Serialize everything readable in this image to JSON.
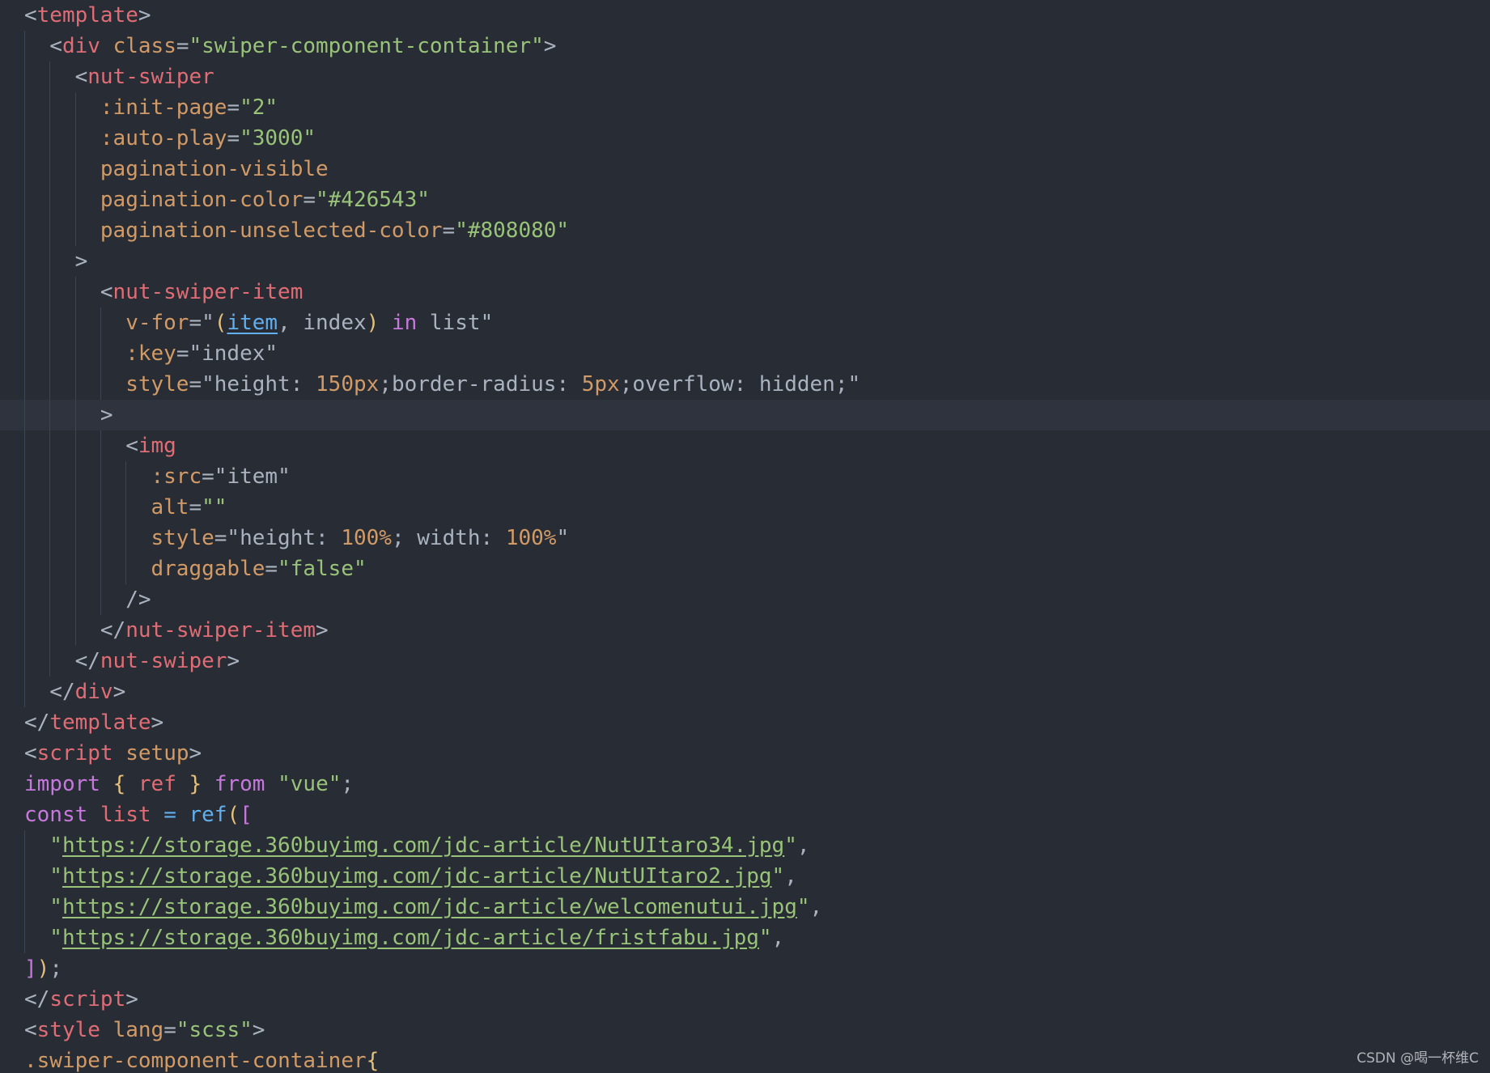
{
  "editor": {
    "active_line": 13,
    "lines": [
      {
        "indent": 0,
        "tokens": [
          [
            "punc",
            "<"
          ],
          [
            "tag",
            "template"
          ],
          [
            "punc",
            ">"
          ]
        ]
      },
      {
        "indent": 1,
        "tokens": [
          [
            "punc",
            "<"
          ],
          [
            "tag",
            "div"
          ],
          [
            "attr",
            " class"
          ],
          [
            "punc",
            "="
          ],
          [
            "str",
            "\"swiper-component-container\""
          ],
          [
            "punc",
            ">"
          ]
        ]
      },
      {
        "indent": 2,
        "tokens": [
          [
            "punc",
            "<"
          ],
          [
            "tag",
            "nut-swiper"
          ]
        ]
      },
      {
        "indent": 3,
        "tokens": [
          [
            "attr",
            ":init-page"
          ],
          [
            "punc",
            "="
          ],
          [
            "str",
            "\"2\""
          ]
        ]
      },
      {
        "indent": 3,
        "tokens": [
          [
            "attr",
            ":auto-play"
          ],
          [
            "punc",
            "="
          ],
          [
            "str",
            "\"3000\""
          ]
        ]
      },
      {
        "indent": 3,
        "tokens": [
          [
            "attr",
            "pagination-visible"
          ]
        ]
      },
      {
        "indent": 3,
        "tokens": [
          [
            "attr",
            "pagination-color"
          ],
          [
            "punc",
            "="
          ],
          [
            "str",
            "\"#426543\""
          ]
        ]
      },
      {
        "indent": 3,
        "tokens": [
          [
            "attr",
            "pagination-unselected-color"
          ],
          [
            "punc",
            "="
          ],
          [
            "str",
            "\"#808080\""
          ]
        ]
      },
      {
        "indent": 2,
        "tokens": [
          [
            "punc",
            ">"
          ]
        ]
      },
      {
        "indent": 3,
        "tokens": [
          [
            "punc",
            "<"
          ],
          [
            "tag",
            "nut-swiper-item"
          ]
        ]
      },
      {
        "indent": 4,
        "tokens": [
          [
            "attr",
            "v-for"
          ],
          [
            "punc",
            "=\""
          ],
          [
            "br1",
            "("
          ],
          [
            "fnlink",
            "item"
          ],
          [
            "punc",
            ", "
          ],
          [
            "plain",
            "index"
          ],
          [
            "br1",
            ")"
          ],
          [
            "plain",
            " "
          ],
          [
            "kw",
            "in"
          ],
          [
            "plain",
            " list"
          ],
          [
            "punc",
            "\""
          ]
        ]
      },
      {
        "indent": 4,
        "tokens": [
          [
            "attr",
            ":key"
          ],
          [
            "punc",
            "=\""
          ],
          [
            "plain",
            "index"
          ],
          [
            "punc",
            "\""
          ]
        ]
      },
      {
        "indent": 4,
        "tokens": [
          [
            "attr",
            "style"
          ],
          [
            "punc",
            "=\""
          ],
          [
            "plain",
            "height: "
          ],
          [
            "num",
            "150px"
          ],
          [
            "plain",
            ";border-radius: "
          ],
          [
            "num",
            "5px"
          ],
          [
            "plain",
            ";overflow: hidden;"
          ],
          [
            "punc",
            "\""
          ]
        ]
      },
      {
        "indent": 3,
        "tokens": [
          [
            "punc",
            ">"
          ]
        ]
      },
      {
        "indent": 4,
        "tokens": [
          [
            "punc",
            "<"
          ],
          [
            "tag",
            "img"
          ]
        ]
      },
      {
        "indent": 5,
        "tokens": [
          [
            "attr",
            ":src"
          ],
          [
            "punc",
            "=\""
          ],
          [
            "plain",
            "item"
          ],
          [
            "punc",
            "\""
          ]
        ]
      },
      {
        "indent": 5,
        "tokens": [
          [
            "attr",
            "alt"
          ],
          [
            "punc",
            "="
          ],
          [
            "str",
            "\"\""
          ]
        ]
      },
      {
        "indent": 5,
        "tokens": [
          [
            "attr",
            "style"
          ],
          [
            "punc",
            "=\""
          ],
          [
            "plain",
            "height: "
          ],
          [
            "num",
            "100%"
          ],
          [
            "plain",
            "; width: "
          ],
          [
            "num",
            "100%"
          ],
          [
            "punc",
            "\""
          ]
        ]
      },
      {
        "indent": 5,
        "tokens": [
          [
            "attr",
            "draggable"
          ],
          [
            "punc",
            "="
          ],
          [
            "str",
            "\"false\""
          ]
        ]
      },
      {
        "indent": 4,
        "tokens": [
          [
            "punc",
            "/>"
          ]
        ]
      },
      {
        "indent": 3,
        "tokens": [
          [
            "punc",
            "</"
          ],
          [
            "tag",
            "nut-swiper-item"
          ],
          [
            "punc",
            ">"
          ]
        ]
      },
      {
        "indent": 2,
        "tokens": [
          [
            "punc",
            "</"
          ],
          [
            "tag",
            "nut-swiper"
          ],
          [
            "punc",
            ">"
          ]
        ]
      },
      {
        "indent": 1,
        "tokens": [
          [
            "punc",
            "</"
          ],
          [
            "tag",
            "div"
          ],
          [
            "punc",
            ">"
          ]
        ]
      },
      {
        "indent": 0,
        "tokens": [
          [
            "punc",
            "</"
          ],
          [
            "tag",
            "template"
          ],
          [
            "punc",
            ">"
          ]
        ]
      },
      {
        "indent": 0,
        "tokens": [
          [
            "punc",
            "<"
          ],
          [
            "tag",
            "script"
          ],
          [
            "attr",
            " setup"
          ],
          [
            "punc",
            ">"
          ]
        ]
      },
      {
        "indent": 0,
        "tokens": [
          [
            "kw",
            "import"
          ],
          [
            "plain",
            " "
          ],
          [
            "br1",
            "{"
          ],
          [
            "plain",
            " "
          ],
          [
            "var",
            "ref"
          ],
          [
            "plain",
            " "
          ],
          [
            "br1",
            "}"
          ],
          [
            "plain",
            " "
          ],
          [
            "kw",
            "from"
          ],
          [
            "plain",
            " "
          ],
          [
            "str",
            "\"vue\""
          ],
          [
            "punc",
            ";"
          ]
        ]
      },
      {
        "indent": 0,
        "tokens": [
          [
            "kw",
            "const"
          ],
          [
            "plain",
            " "
          ],
          [
            "var",
            "list"
          ],
          [
            "plain",
            " "
          ],
          [
            "fn",
            "="
          ],
          [
            "plain",
            " "
          ],
          [
            "fn",
            "ref"
          ],
          [
            "br1",
            "("
          ],
          [
            "br2",
            "["
          ]
        ]
      },
      {
        "indent": 1,
        "tokens": [
          [
            "str",
            "\""
          ],
          [
            "strlink",
            "https://storage.360buyimg.com/jdc-article/NutUItaro34.jpg"
          ],
          [
            "str",
            "\""
          ],
          [
            "punc",
            ","
          ]
        ]
      },
      {
        "indent": 1,
        "tokens": [
          [
            "str",
            "\""
          ],
          [
            "strlink",
            "https://storage.360buyimg.com/jdc-article/NutUItaro2.jpg"
          ],
          [
            "str",
            "\""
          ],
          [
            "punc",
            ","
          ]
        ]
      },
      {
        "indent": 1,
        "tokens": [
          [
            "str",
            "\""
          ],
          [
            "strlink",
            "https://storage.360buyimg.com/jdc-article/welcomenutui.jpg"
          ],
          [
            "str",
            "\""
          ],
          [
            "punc",
            ","
          ]
        ]
      },
      {
        "indent": 1,
        "tokens": [
          [
            "str",
            "\""
          ],
          [
            "strlink",
            "https://storage.360buyimg.com/jdc-article/fristfabu.jpg"
          ],
          [
            "str",
            "\""
          ],
          [
            "punc",
            ","
          ]
        ]
      },
      {
        "indent": 0,
        "tokens": [
          [
            "br2",
            "]"
          ],
          [
            "br1",
            ")"
          ],
          [
            "punc",
            ";"
          ]
        ]
      },
      {
        "indent": 0,
        "tokens": [
          [
            "punc",
            "</"
          ],
          [
            "tag",
            "script"
          ],
          [
            "punc",
            ">"
          ]
        ]
      },
      {
        "indent": 0,
        "tokens": [
          [
            "punc",
            "<"
          ],
          [
            "tag",
            "style"
          ],
          [
            "attr",
            " lang"
          ],
          [
            "punc",
            "="
          ],
          [
            "str",
            "\"scss\""
          ],
          [
            "punc",
            ">"
          ]
        ]
      },
      {
        "indent": 0,
        "tokens": [
          [
            "attr",
            ".swiper-component-container"
          ],
          [
            "br1",
            "{"
          ]
        ]
      }
    ]
  },
  "watermark": "CSDN @喝一杯维C"
}
